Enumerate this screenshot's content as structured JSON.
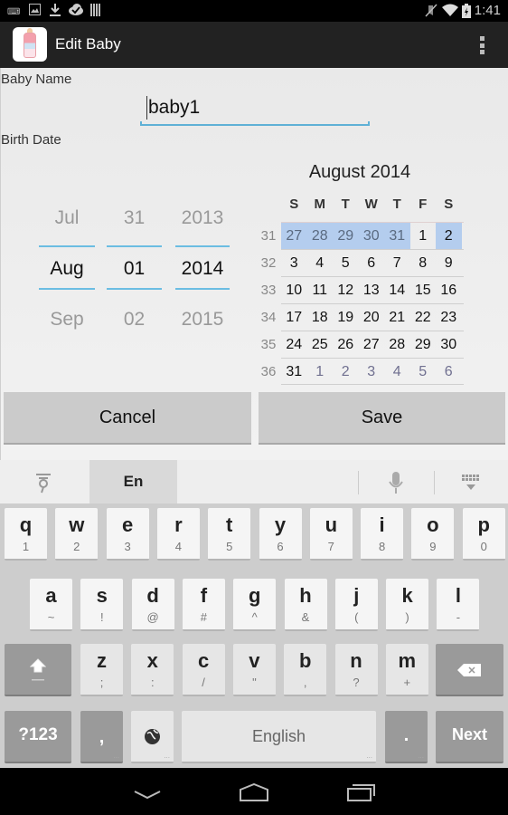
{
  "status_bar": {
    "time": "1:41",
    "left_icons": [
      "keyboard-icon",
      "image-icon",
      "download-icon",
      "cloud-check-icon",
      "barcode-icon"
    ],
    "right_icons": [
      "mute-icon",
      "wifi-icon",
      "battery-charging-icon"
    ]
  },
  "action_bar": {
    "title": "Edit Baby",
    "app_icon": "baby-bottle-icon",
    "overflow_icon": "overflow-menu-icon"
  },
  "form": {
    "baby_name_label": "Baby Name",
    "baby_name_value": "baby1",
    "birth_date_label": "Birth Date"
  },
  "date_spinner": {
    "month": {
      "prev": "Jul",
      "current": "Aug",
      "next": "Sep"
    },
    "day": {
      "prev": "31",
      "current": "01",
      "next": "02"
    },
    "year": {
      "prev": "2013",
      "current": "2014",
      "next": "2015"
    }
  },
  "calendar": {
    "title": "August 2014",
    "weekdays": [
      "S",
      "M",
      "T",
      "W",
      "T",
      "F",
      "S"
    ],
    "weeks": [
      {
        "num": "31",
        "days": [
          {
            "d": "27",
            "other": true,
            "hl": true
          },
          {
            "d": "28",
            "other": true,
            "hl": true
          },
          {
            "d": "29",
            "other": true,
            "hl": true
          },
          {
            "d": "30",
            "other": true,
            "hl": true
          },
          {
            "d": "31",
            "other": true,
            "hl": true
          },
          {
            "d": "1",
            "other": false,
            "hl": false
          },
          {
            "d": "2",
            "other": false,
            "hl": true
          }
        ]
      },
      {
        "num": "32",
        "days": [
          {
            "d": "3"
          },
          {
            "d": "4"
          },
          {
            "d": "5"
          },
          {
            "d": "6"
          },
          {
            "d": "7"
          },
          {
            "d": "8"
          },
          {
            "d": "9"
          }
        ]
      },
      {
        "num": "33",
        "days": [
          {
            "d": "10"
          },
          {
            "d": "11"
          },
          {
            "d": "12"
          },
          {
            "d": "13"
          },
          {
            "d": "14"
          },
          {
            "d": "15"
          },
          {
            "d": "16"
          }
        ]
      },
      {
        "num": "34",
        "days": [
          {
            "d": "17"
          },
          {
            "d": "18"
          },
          {
            "d": "19"
          },
          {
            "d": "20"
          },
          {
            "d": "21"
          },
          {
            "d": "22"
          },
          {
            "d": "23"
          }
        ]
      },
      {
        "num": "35",
        "days": [
          {
            "d": "24"
          },
          {
            "d": "25"
          },
          {
            "d": "26"
          },
          {
            "d": "27"
          },
          {
            "d": "28"
          },
          {
            "d": "29"
          },
          {
            "d": "30"
          }
        ]
      },
      {
        "num": "36",
        "days": [
          {
            "d": "31"
          },
          {
            "d": "1",
            "other": true
          },
          {
            "d": "2",
            "other": true
          },
          {
            "d": "3",
            "other": true
          },
          {
            "d": "4",
            "other": true
          },
          {
            "d": "5",
            "other": true
          },
          {
            "d": "6",
            "other": true
          }
        ]
      }
    ],
    "highlight_color": "#b4cdee"
  },
  "buttons": {
    "cancel": "Cancel",
    "save": "Save"
  },
  "keyboard": {
    "suggestion_strip": {
      "language": "En",
      "left_icon": "text-cursor-icon",
      "mic_icon": "microphone-icon",
      "hide_icon": "hide-keyboard-icon"
    },
    "row1": [
      {
        "k": "q",
        "s": "1"
      },
      {
        "k": "w",
        "s": "2"
      },
      {
        "k": "e",
        "s": "3"
      },
      {
        "k": "r",
        "s": "4"
      },
      {
        "k": "t",
        "s": "5"
      },
      {
        "k": "y",
        "s": "6"
      },
      {
        "k": "u",
        "s": "7"
      },
      {
        "k": "i",
        "s": "8"
      },
      {
        "k": "o",
        "s": "9"
      },
      {
        "k": "p",
        "s": "0"
      }
    ],
    "row2": [
      {
        "k": "a",
        "s": "~"
      },
      {
        "k": "s",
        "s": "!"
      },
      {
        "k": "d",
        "s": "@"
      },
      {
        "k": "f",
        "s": "#"
      },
      {
        "k": "g",
        "s": "^"
      },
      {
        "k": "h",
        "s": "&"
      },
      {
        "k": "j",
        "s": "("
      },
      {
        "k": "k",
        "s": ")"
      },
      {
        "k": "l",
        "s": "-"
      }
    ],
    "row3": [
      {
        "k": "z",
        "s": ";"
      },
      {
        "k": "x",
        "s": ":"
      },
      {
        "k": "c",
        "s": "/"
      },
      {
        "k": "v",
        "s": "\""
      },
      {
        "k": "b",
        "s": ","
      },
      {
        "k": "n",
        "s": "?"
      },
      {
        "k": "m",
        "s": "+"
      }
    ],
    "symbols_key": "?123",
    "comma_key": ",",
    "space_label": "English",
    "period_key": ".",
    "action_key": "Next"
  },
  "nav_bar": {
    "back": "back-icon",
    "home": "home-icon",
    "recents": "recents-icon"
  }
}
